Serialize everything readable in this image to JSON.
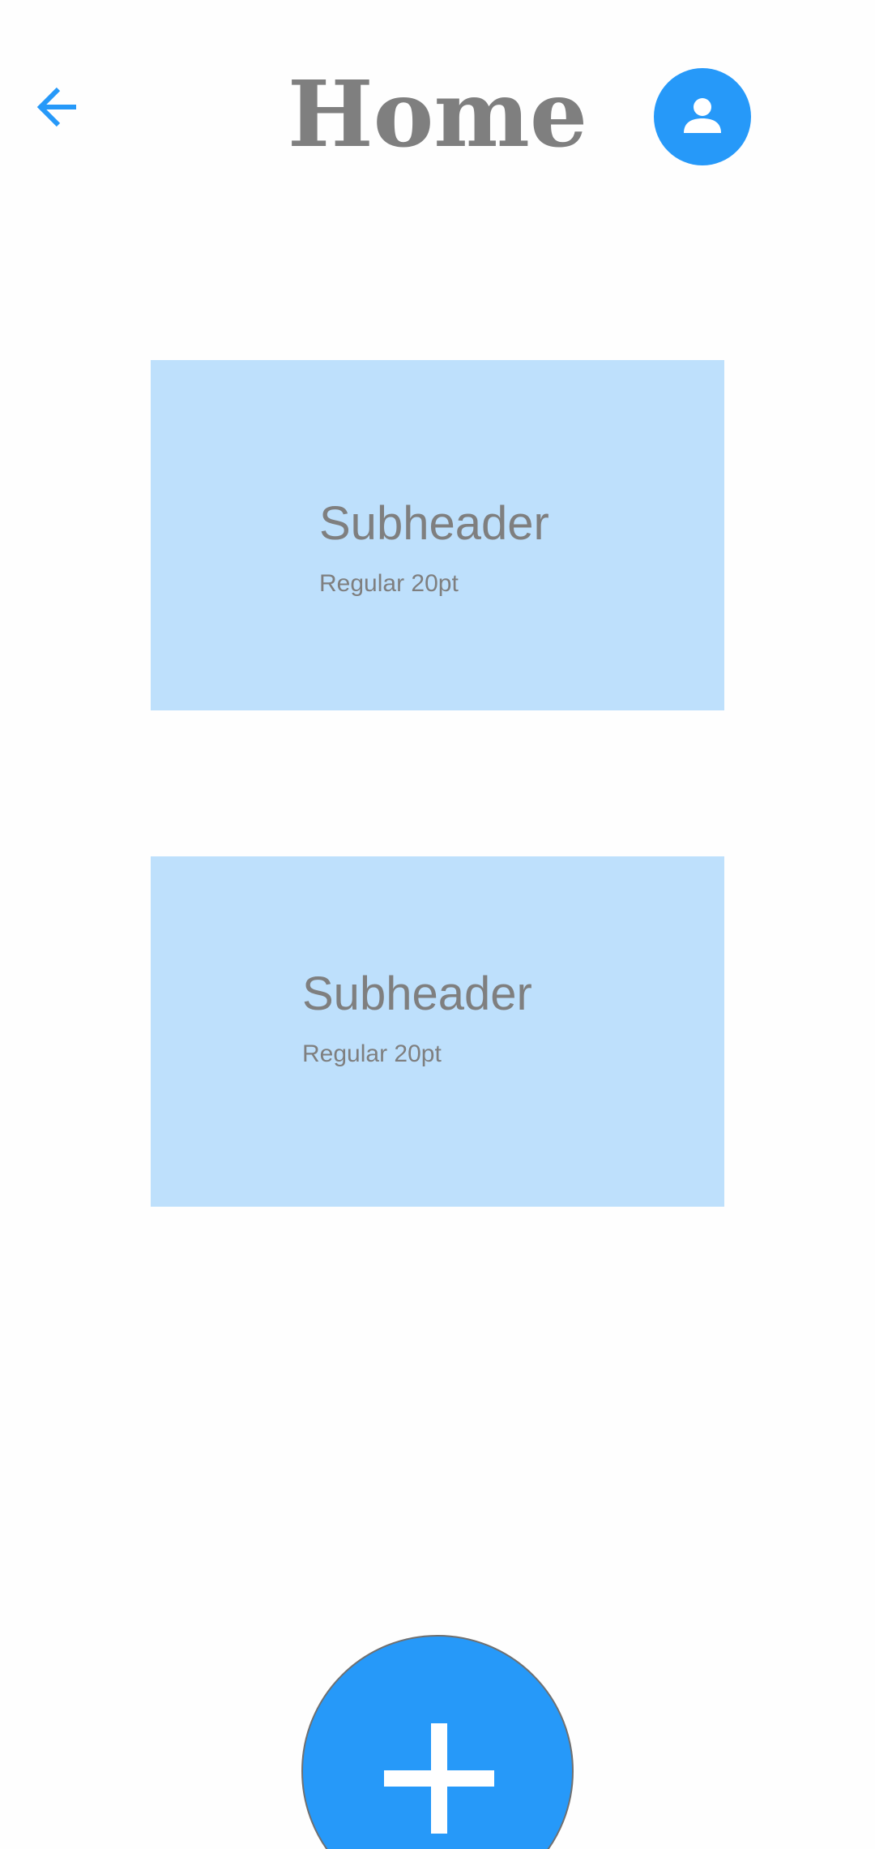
{
  "header": {
    "back_icon": "arrow-left-icon",
    "title": "Home",
    "profile_icon": "person-icon"
  },
  "cards": [
    {
      "subheader": "Subheader",
      "body": "Regular 20pt"
    },
    {
      "subheader": "Subheader",
      "body": "Regular 20pt"
    }
  ],
  "fab": {
    "icon": "plus-icon"
  },
  "colors": {
    "accent": "#2699f9",
    "card_background": "#bee0fc",
    "text_gray": "#7f7f7f",
    "background": "#fefefe"
  }
}
